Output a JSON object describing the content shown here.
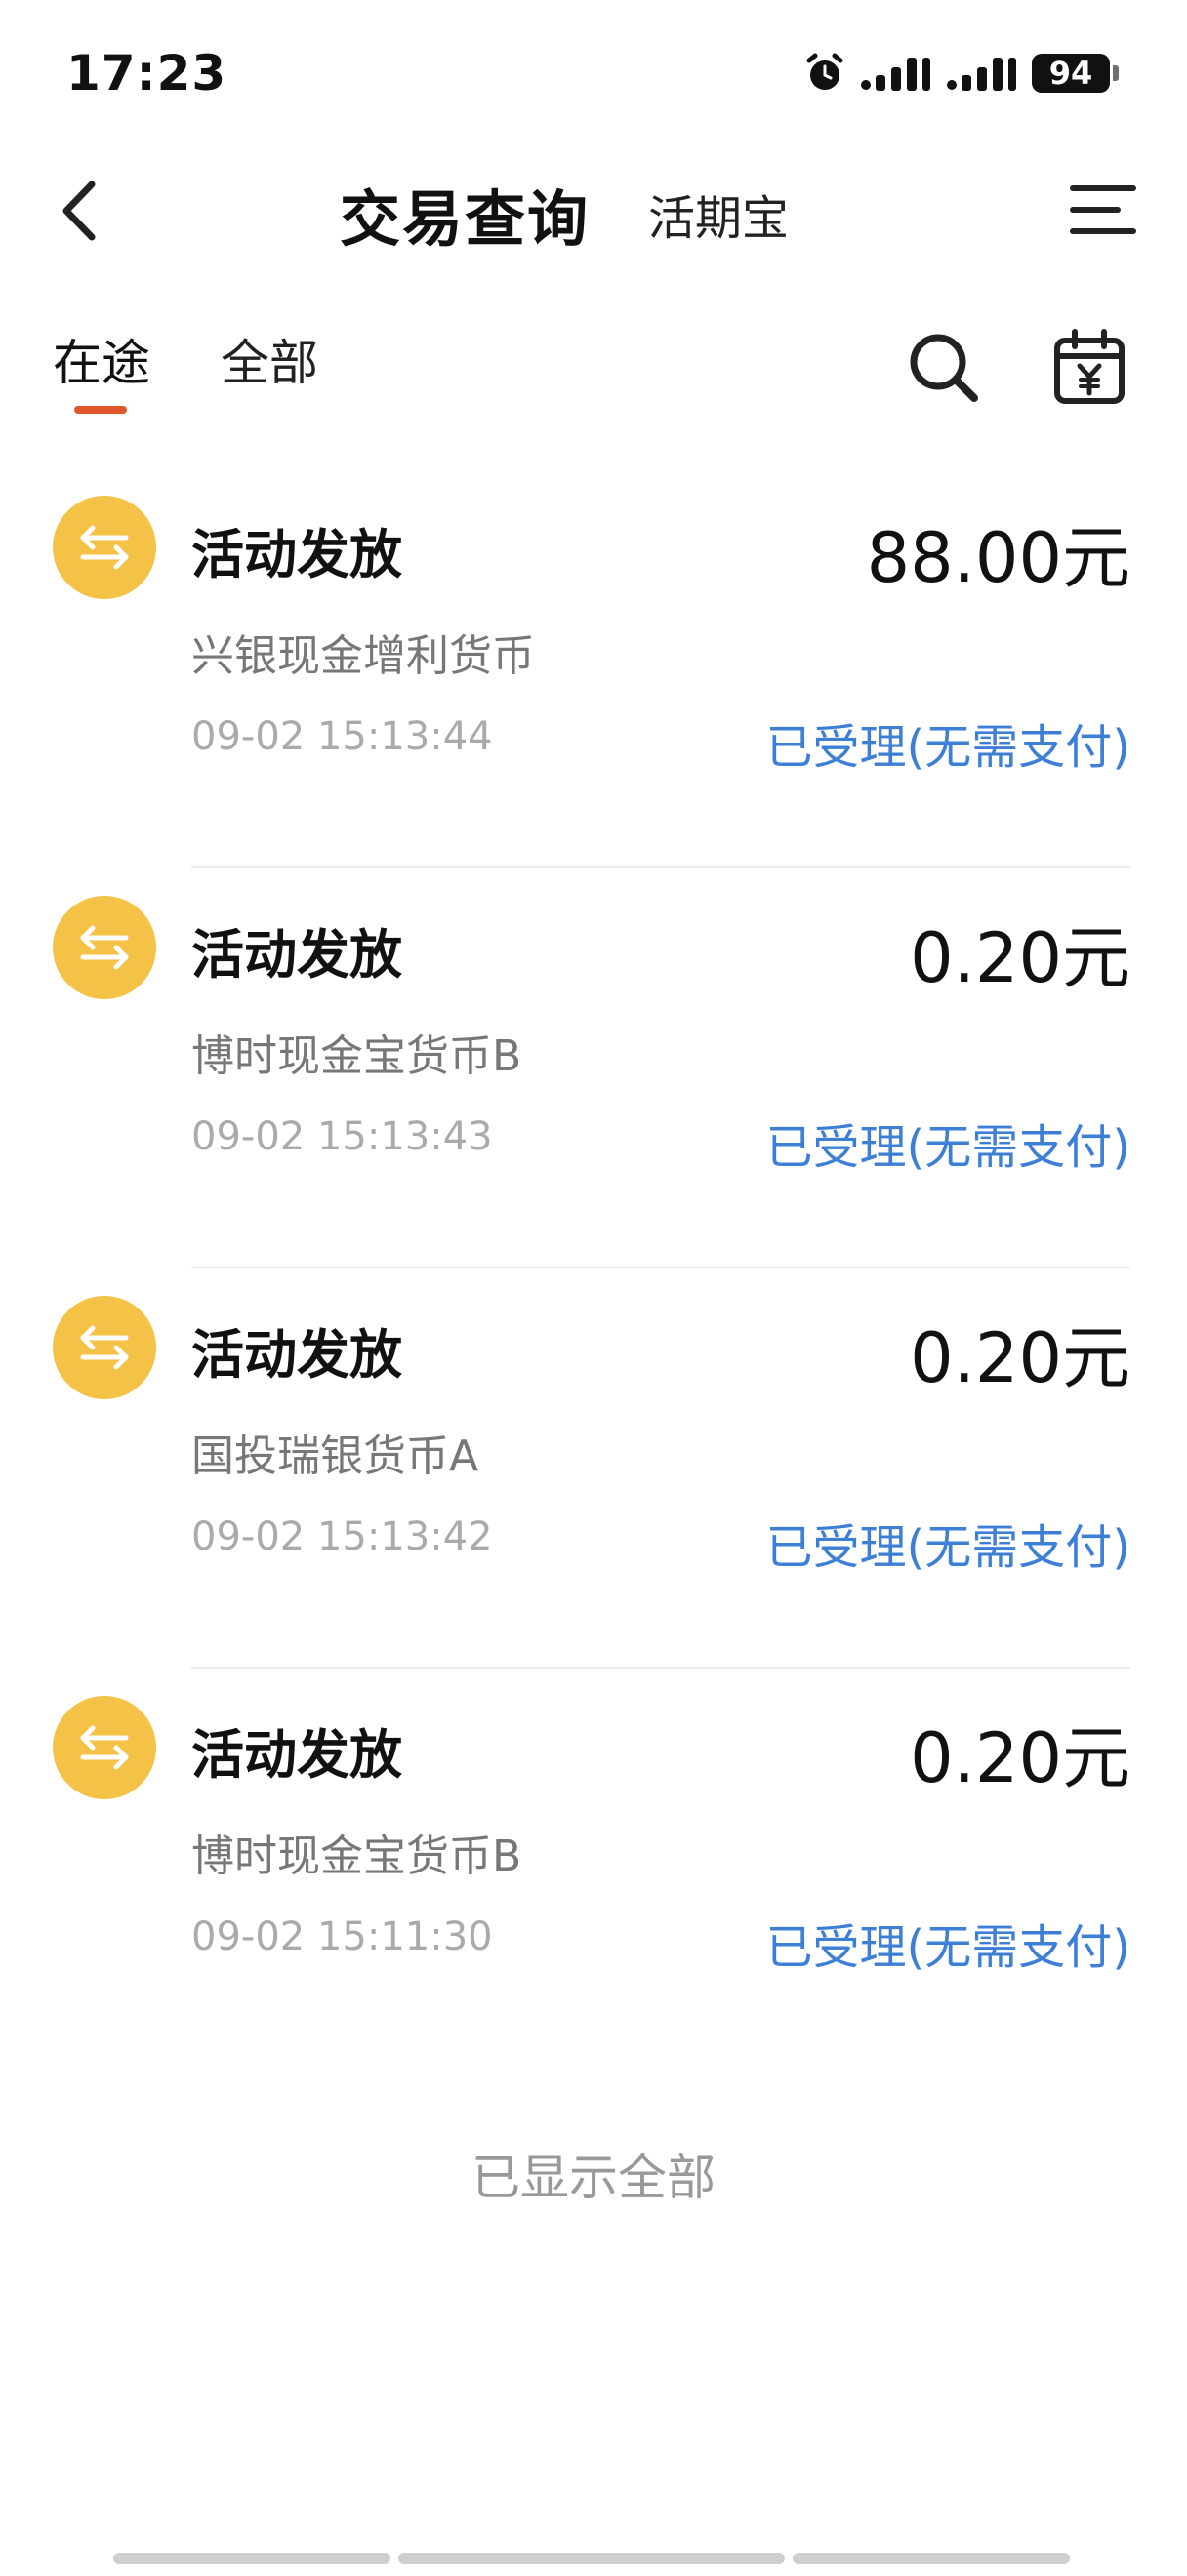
{
  "status_bar": {
    "time": "17:23",
    "battery": "94"
  },
  "header": {
    "title": "交易查询",
    "subtitle": "活期宝"
  },
  "tabs": [
    {
      "label": "在途",
      "active": true
    },
    {
      "label": "全部",
      "active": false
    }
  ],
  "colors": {
    "accent": "#e2562b",
    "icon_bg": "#f4c247",
    "status_blue": "#3d7fd6"
  },
  "transactions": [
    {
      "title": "活动发放",
      "amount": "88.00元",
      "fund": "兴银现金增利货币",
      "time": "09-02 15:13:44",
      "status": "已受理(无需支付)",
      "icon": "transfer-icon"
    },
    {
      "title": "活动发放",
      "amount": "0.20元",
      "fund": "博时现金宝货币B",
      "time": "09-02 15:13:43",
      "status": "已受理(无需支付)",
      "icon": "transfer-icon"
    },
    {
      "title": "活动发放",
      "amount": "0.20元",
      "fund": "国投瑞银货币A",
      "time": "09-02 15:13:42",
      "status": "已受理(无需支付)",
      "icon": "transfer-icon"
    },
    {
      "title": "活动发放",
      "amount": "0.20元",
      "fund": "博时现金宝货币B",
      "time": "09-02 15:11:30",
      "status": "已受理(无需支付)",
      "icon": "transfer-icon"
    }
  ],
  "footer": {
    "note": "已显示全部"
  }
}
